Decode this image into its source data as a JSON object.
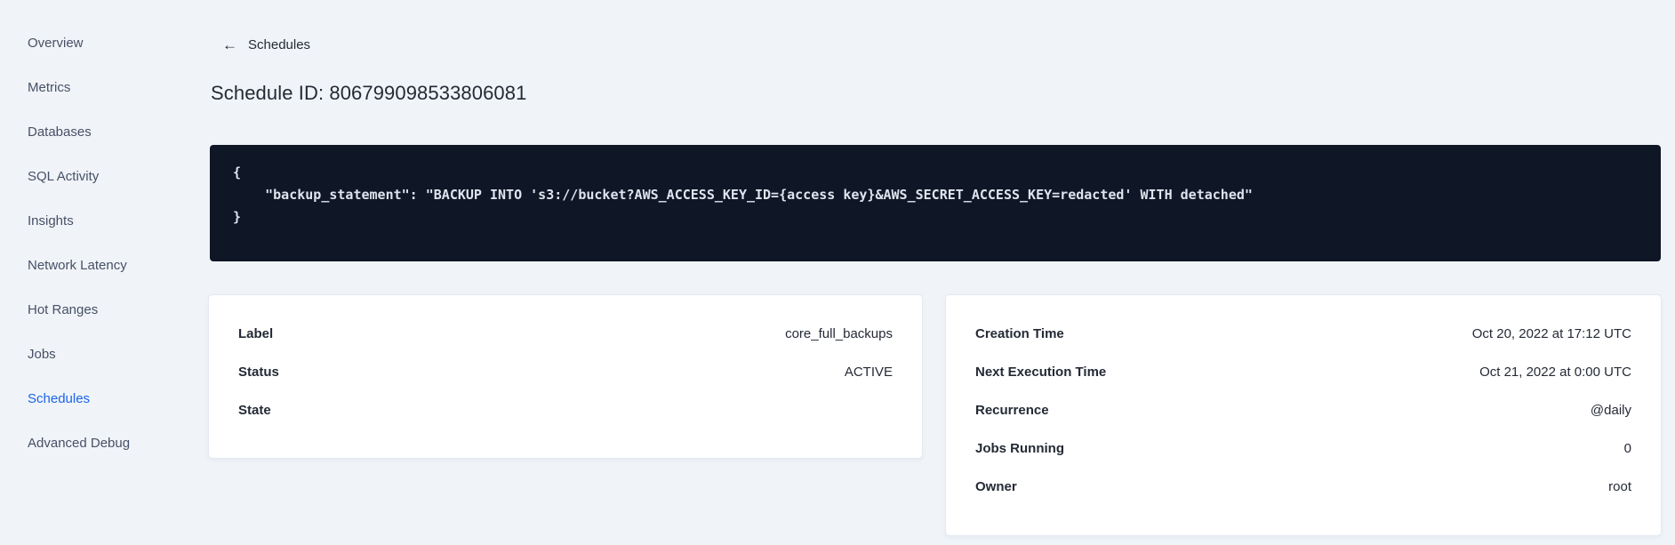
{
  "sidebar": {
    "items": [
      {
        "label": "Overview",
        "active": false
      },
      {
        "label": "Metrics",
        "active": false
      },
      {
        "label": "Databases",
        "active": false
      },
      {
        "label": "SQL Activity",
        "active": false
      },
      {
        "label": "Insights",
        "active": false
      },
      {
        "label": "Network Latency",
        "active": false
      },
      {
        "label": "Hot Ranges",
        "active": false
      },
      {
        "label": "Jobs",
        "active": false
      },
      {
        "label": "Schedules",
        "active": true
      },
      {
        "label": "Advanced Debug",
        "active": false
      }
    ]
  },
  "header": {
    "back_label": "Schedules",
    "back_icon": "arrow-left",
    "title": "Schedule ID: 806799098533806081"
  },
  "code_block": {
    "content": "{\n    \"backup_statement\": \"BACKUP INTO 's3://bucket?AWS_ACCESS_KEY_ID={access key}&AWS_SECRET_ACCESS_KEY=redacted' WITH detached\"\n}"
  },
  "detail_card": {
    "rows": [
      {
        "label": "Label",
        "value": "core_full_backups"
      },
      {
        "label": "Status",
        "value": "ACTIVE"
      },
      {
        "label": "State",
        "value": ""
      }
    ]
  },
  "schedule_card": {
    "rows": [
      {
        "label": "Creation Time",
        "value": "Oct 20, 2022 at 17:12 UTC"
      },
      {
        "label": "Next Execution Time",
        "value": "Oct 21, 2022 at 0:00 UTC"
      },
      {
        "label": "Recurrence",
        "value": "@daily"
      },
      {
        "label": "Jobs Running",
        "value": "0"
      },
      {
        "label": "Owner",
        "value": "root"
      }
    ]
  },
  "colors": {
    "accent_blue": "#1c63e8",
    "page_background": "#f0f4f8",
    "code_background": "#0f1626",
    "code_text": "#dee5ee",
    "text_dark": "#242a35",
    "sidebar_text": "#475066",
    "card_border": "#e4eaf1"
  }
}
